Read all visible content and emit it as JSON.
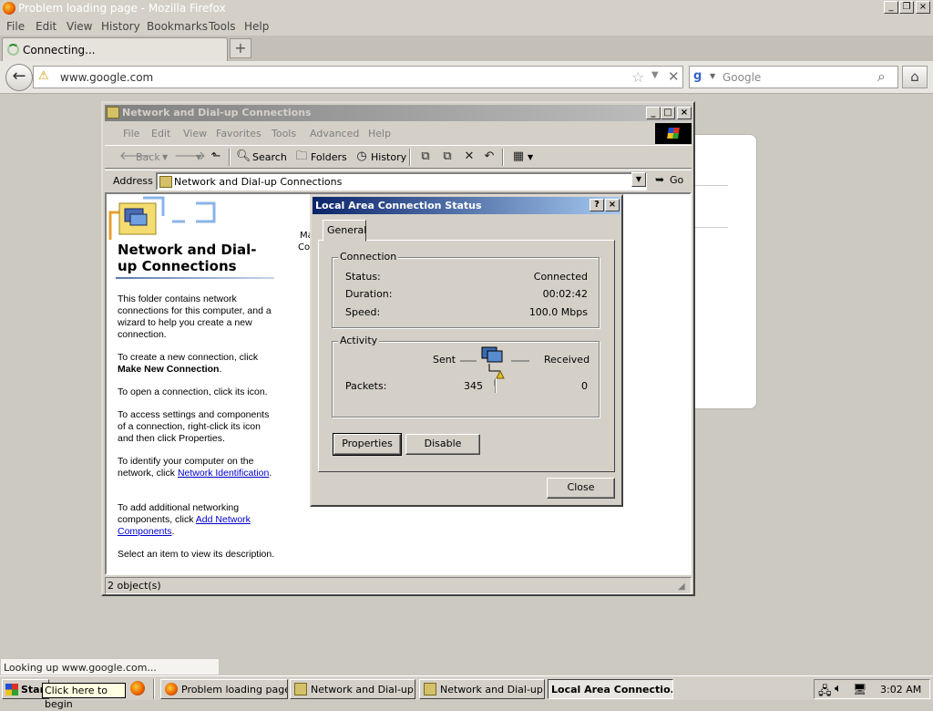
{
  "firefox": {
    "window_title": "Problem loading page - Mozilla Firefox",
    "menu": [
      "File",
      "Edit",
      "View",
      "History",
      "Bookmarks",
      "Tools",
      "Help"
    ],
    "tab_label": "Connecting...",
    "new_tab": "+",
    "url": "www.google.com",
    "search_placeholder": "Google",
    "status": "Looking up www.google.com..."
  },
  "explorer": {
    "title": "Network and Dial-up Connections",
    "menu": [
      "File",
      "Edit",
      "View",
      "Favorites",
      "Tools",
      "Advanced",
      "Help"
    ],
    "toolbar": {
      "back": "Back",
      "search": "Search",
      "folders": "Folders",
      "history": "History"
    },
    "address_label": "Address",
    "address_value": "Network and Dial-up Connections",
    "go": "Go",
    "pane": {
      "heading": "Network and Dial-up Connections",
      "p1": "This folder contains network connections for this computer, and a wizard to help you create a new connection.",
      "p2_pre": "To create a new connection, click",
      "p2_bold": "Make New Connection",
      "p2_post": ".",
      "p3": "To open a connection, click its icon.",
      "p4": "To access settings and components of a connection, right-click its icon and then click Properties.",
      "p5_pre": "To identify your computer on the network, click",
      "p5_link": "Network Identification",
      "p5_post": ".",
      "p6_pre": "To add additional networking components, click",
      "p6_link": "Add Network Components",
      "p6_post": ".",
      "p7": "Select an item to view its description.",
      "icon_label_1": "Ma",
      "icon_label_2": "Co"
    },
    "status": "2 object(s)"
  },
  "dialog": {
    "title": "Local Area Connection Status",
    "help": "?",
    "close_x": "×",
    "tab": "General",
    "connection": {
      "legend": "Connection",
      "status_label": "Status:",
      "status_value": "Connected",
      "duration_label": "Duration:",
      "duration_value": "00:02:42",
      "speed_label": "Speed:",
      "speed_value": "100.0 Mbps"
    },
    "activity": {
      "legend": "Activity",
      "sent": "Sent",
      "received": "Received",
      "packets_label": "Packets:",
      "packets_sent": "345",
      "packets_received": "0"
    },
    "properties_button": "Properties",
    "disable_button": "Disable",
    "close_button": "Close"
  },
  "taskbar": {
    "start": "Start",
    "tooltip": "Click here to begin",
    "tasks": [
      {
        "label": "Problem loading page..."
      },
      {
        "label": "Network and Dial-up ..."
      },
      {
        "label": "Network and Dial-up ..."
      },
      {
        "label": "Local Area Connectio..."
      }
    ],
    "clock": "3:02 AM"
  }
}
